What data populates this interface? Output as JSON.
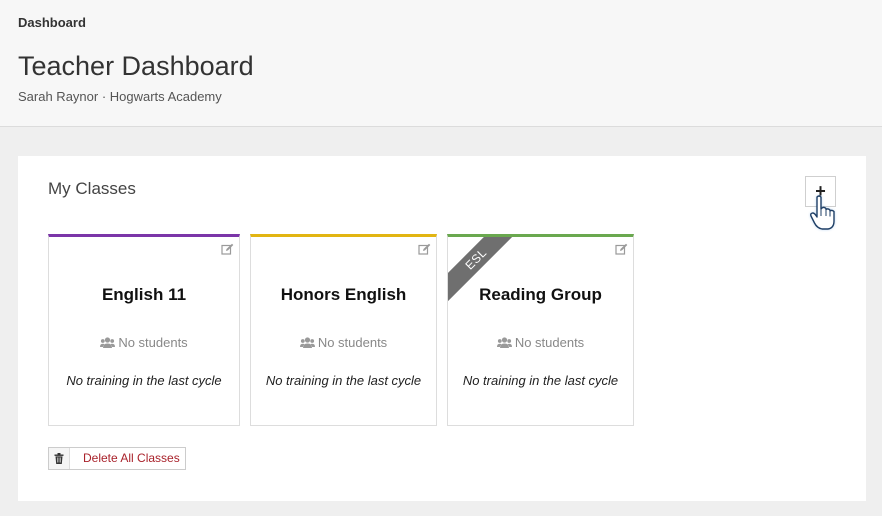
{
  "header": {
    "breadcrumb": "Dashboard",
    "title": "Teacher Dashboard",
    "subtitle": "Sarah Raynor · Hogwarts Academy"
  },
  "classes_panel": {
    "title": "My Classes",
    "add_label": "+",
    "classes": [
      {
        "name": "English 11",
        "students": "No students",
        "training": "No training in the last cycle",
        "accent": "#7b35a8",
        "ribbon": ""
      },
      {
        "name": "Honors English",
        "students": "No students",
        "training": "No training in the last cycle",
        "accent": "#e2b512",
        "ribbon": ""
      },
      {
        "name": "Reading Group",
        "students": "No students",
        "training": "No training in the last cycle",
        "accent": "#6aa84f",
        "ribbon": "ESL"
      }
    ],
    "delete_all_label": "Delete All Classes"
  },
  "colors": {
    "danger": "#a9222b",
    "ribbon": "#6f6f6f"
  },
  "icons": {
    "edit": "edit-icon",
    "students": "users-icon",
    "delete": "trash-icon",
    "cursor": "hand-pointer-icon"
  }
}
